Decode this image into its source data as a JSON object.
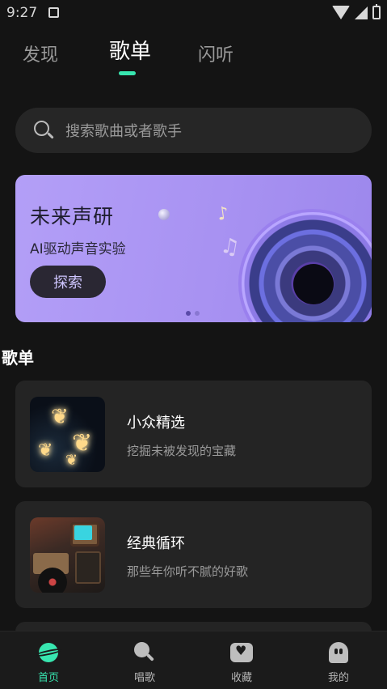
{
  "status_bar": {
    "time": "9:27"
  },
  "top_tabs": [
    {
      "label": "发现",
      "active": false
    },
    {
      "label": "歌单",
      "active": true
    },
    {
      "label": "闪听",
      "active": false
    }
  ],
  "search": {
    "placeholder": "搜索歌曲或者歌手"
  },
  "banner": {
    "title": "未来声研",
    "subtitle": "AI驱动声音实验",
    "button_label": "探索",
    "page_index": 0,
    "page_count": 2
  },
  "section": {
    "title": "歌单"
  },
  "playlists": [
    {
      "title": "小众精选",
      "subtitle": "挖掘未被发现的宝藏"
    },
    {
      "title": "经典循环",
      "subtitle": "那些年你听不腻的好歌"
    }
  ],
  "bottom_nav": [
    {
      "label": "首页",
      "icon": "planet-icon",
      "active": true
    },
    {
      "label": "唱歌",
      "icon": "microphone-icon",
      "active": false
    },
    {
      "label": "收藏",
      "icon": "heart-box-icon",
      "active": false
    },
    {
      "label": "我的",
      "icon": "ghost-icon",
      "active": false
    }
  ],
  "colors": {
    "accent": "#38e6b0",
    "background": "#141414",
    "card": "#242424",
    "banner": "#a892f2"
  }
}
